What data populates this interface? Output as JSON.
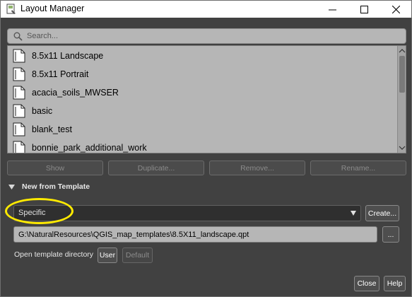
{
  "window": {
    "title": "Layout Manager",
    "controls": {
      "minimize_icon": "minimize-icon",
      "maximize_icon": "maximize-icon",
      "close_icon": "close-icon"
    }
  },
  "search": {
    "placeholder": "Search...",
    "value": ""
  },
  "layouts": {
    "items": [
      {
        "label": "8.5x11 Landscape",
        "icon": "layout-document-icon"
      },
      {
        "label": "8.5x11 Portrait",
        "icon": "layout-document-icon"
      },
      {
        "label": "acacia_soils_MWSER",
        "icon": "layout-document-icon"
      },
      {
        "label": "basic",
        "icon": "layout-document-icon"
      },
      {
        "label": "blank_test",
        "icon": "layout-document-icon"
      },
      {
        "label": "bonnie_park_additional_work",
        "icon": "layout-document-icon"
      }
    ]
  },
  "actions": {
    "show": "Show",
    "duplicate": "Duplicate...",
    "remove": "Remove...",
    "rename": "Rename..."
  },
  "new_from_template": {
    "header": "New from Template",
    "template_type": "Specific",
    "create_label": "Create...",
    "template_path": "G:\\NaturalResources\\QGIS_map_templates\\8.5X11_landscape.qpt",
    "browse_label": "...",
    "open_dir_label": "Open template directory",
    "user_label": "User",
    "default_label": "Default"
  },
  "footer": {
    "close_label": "Close",
    "help_label": "Help"
  },
  "colors": {
    "background": "#414141",
    "list_bg": "#b6b6b6",
    "highlight": "#ffea00"
  }
}
